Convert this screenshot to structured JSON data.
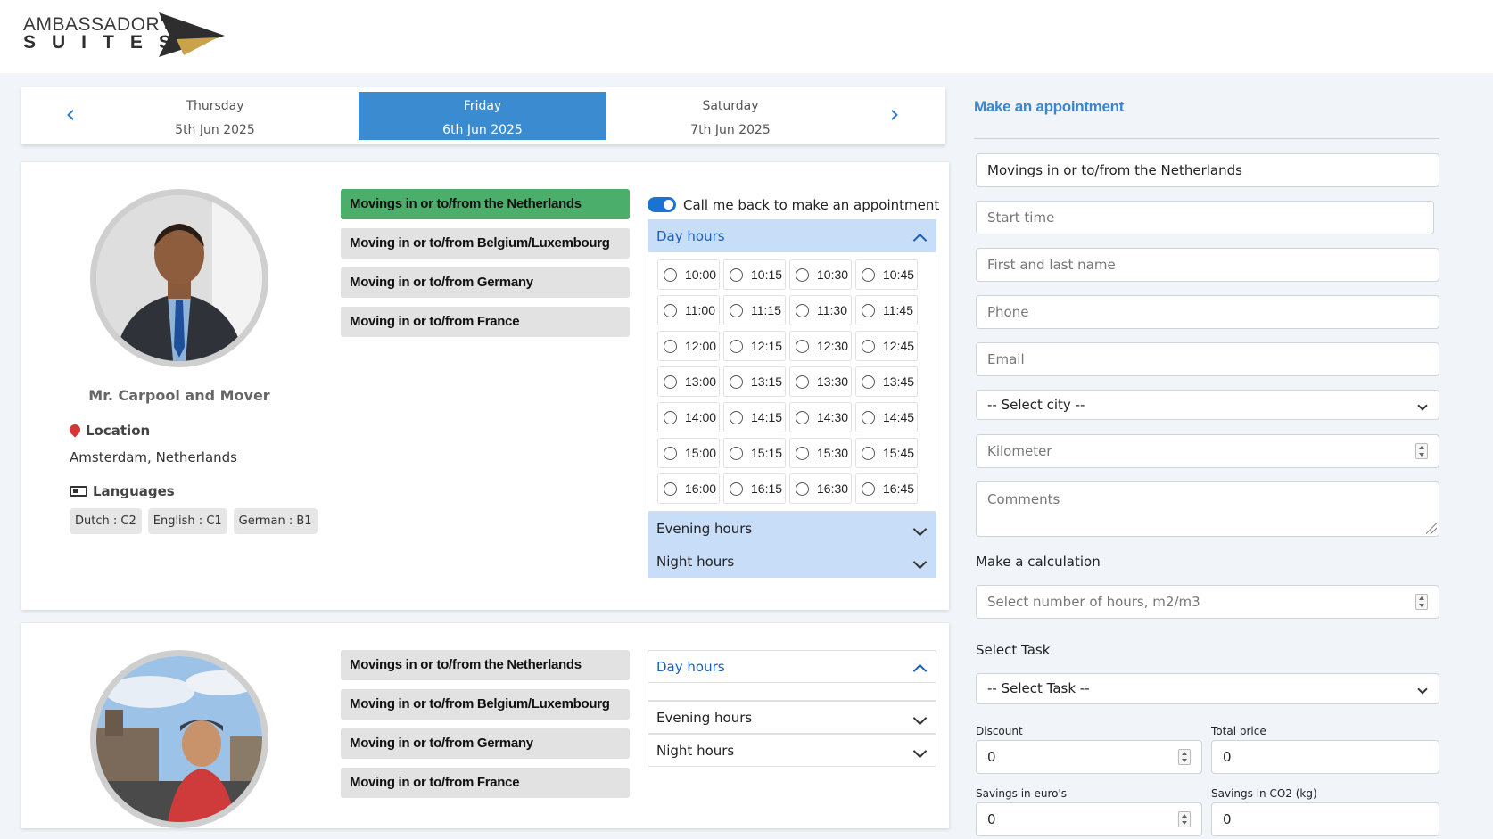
{
  "brand": {
    "line1": "AMBASSADOR'S",
    "line2": "SUITES",
    "colors": {
      "dark": "#2e2e2e",
      "gold": "#c9a24a"
    }
  },
  "date_nav": {
    "prev_icon": "chevron-left-icon",
    "next_icon": "chevron-right-icon",
    "days": [
      {
        "name": "Thursday",
        "date": "5th Jun 2025"
      },
      {
        "name": "Friday",
        "date": "6th Jun 2025"
      },
      {
        "name": "Saturday",
        "date": "7th Jun 2025"
      }
    ]
  },
  "provider1": {
    "name": "Mr. Carpool and Mover",
    "location_label": "Location",
    "location": "Amsterdam, Netherlands",
    "languages_label": "Languages",
    "languages": [
      "Dutch : C2",
      "English : C1",
      "German : B1"
    ],
    "services": [
      "Movings in or to/from the Netherlands",
      "Moving in or to/from Belgium/Luxembourg",
      "Moving in or to/from Germany",
      "Moving in or to/from France"
    ],
    "callback_label": "Call me back to make an appointment",
    "day_hours_label": "Day hours",
    "evening_hours_label": "Evening hours",
    "night_hours_label": "Night hours",
    "slots": [
      "10:00",
      "10:15",
      "10:30",
      "10:45",
      "11:00",
      "11:15",
      "11:30",
      "11:45",
      "12:00",
      "12:15",
      "12:30",
      "12:45",
      "13:00",
      "13:15",
      "13:30",
      "13:45",
      "14:00",
      "14:15",
      "14:30",
      "14:45",
      "15:00",
      "15:15",
      "15:30",
      "15:45",
      "16:00",
      "16:15",
      "16:30",
      "16:45"
    ]
  },
  "provider2": {
    "services": [
      "Movings in or to/from the Netherlands",
      "Moving in or to/from Belgium/Luxembourg",
      "Moving in or to/from Germany",
      "Moving in or to/from France"
    ],
    "day_hours_label": "Day hours",
    "evening_hours_label": "Evening hours",
    "night_hours_label": "Night hours"
  },
  "appointment": {
    "title": "Make an appointment",
    "service_value": "Movings in or to/from the Netherlands",
    "start_time_placeholder": "Start time",
    "name_placeholder": "First and last name",
    "phone_placeholder": "Phone",
    "email_placeholder": "Email",
    "city_select": "-- Select city --",
    "kilometer_placeholder": "Kilometer",
    "comments_placeholder": "Comments",
    "calc_label": "Make a calculation",
    "hours_placeholder": "Select number of hours, m2/m3",
    "task_label": "Select Task",
    "task_select": "-- Select Task --",
    "discount_label": "Discount",
    "discount_value": "0",
    "total_label": "Total price",
    "total_value": "0",
    "savings_euro_label": "Savings in euro's",
    "savings_euro_value": "0",
    "savings_co2_label": "Savings in CO2 (kg)",
    "savings_co2_value": "0"
  }
}
